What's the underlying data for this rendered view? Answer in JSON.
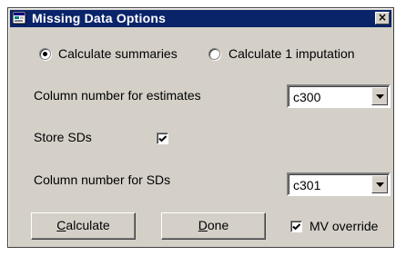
{
  "window": {
    "title": "Missing Data Options",
    "close_glyph": "×"
  },
  "radios": [
    {
      "label": "Calculate summaries",
      "selected": true
    },
    {
      "label": "Calculate 1 imputation",
      "selected": false
    }
  ],
  "estimates": {
    "label": "Column number for estimates",
    "value": "c300"
  },
  "store_sds": {
    "label": "Store SDs",
    "checked": true
  },
  "sds": {
    "label": "Column number for SDs",
    "value": "c301"
  },
  "buttons": {
    "calculate": {
      "mnemonic": "C",
      "rest": "alculate"
    },
    "done": {
      "mnemonic": "D",
      "rest": "one"
    }
  },
  "mv_override": {
    "label": "MV override",
    "checked": true
  },
  "colors": {
    "titlebar": "#0a246a",
    "face": "#d4d0c8"
  },
  "icons": {
    "app": "app-icon",
    "close": "close-icon",
    "dropdown": "chevron-down-icon",
    "check": "checkmark-icon"
  }
}
